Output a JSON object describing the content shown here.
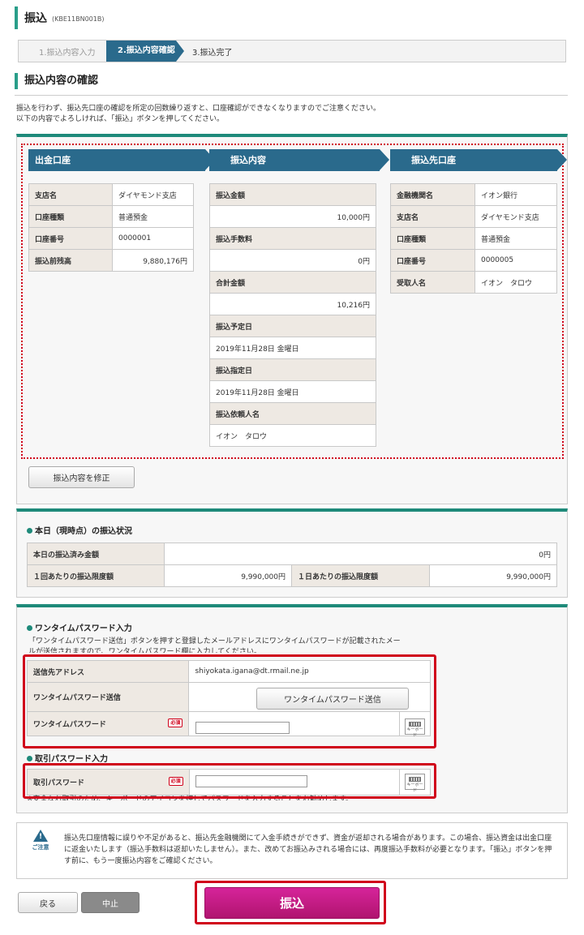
{
  "header": {
    "title": "振込",
    "code": "(KBE11BN001B)"
  },
  "steps": [
    "1.振込内容入力",
    "2.振込内容確認",
    "3.振込完了"
  ],
  "section_title": "振込内容の確認",
  "intro": [
    "振込を行わず、振込先口座の確認を所定の回数繰り返すと、口座確認ができなくなりますのでご注意ください。",
    "以下の内容でよろしければ、「振込」ボタンを押してください。"
  ],
  "from_account": {
    "heading": "出金口座",
    "rows": [
      {
        "label": "支店名",
        "value": "ダイヤモンド支店"
      },
      {
        "label": "口座種類",
        "value": "普通預金"
      },
      {
        "label": "口座番号",
        "value": "0000001"
      },
      {
        "label": "振込前残高",
        "value": "9,880,176円"
      }
    ]
  },
  "transfer": {
    "heading": "振込内容",
    "rows": [
      {
        "label": "振込金額",
        "value": "10,000円"
      },
      {
        "label": "振込手数料",
        "value": "0円"
      },
      {
        "label": "合計金額",
        "value": "10,216円"
      },
      {
        "label": "振込予定日",
        "value": "2019年11月28日 金曜日"
      },
      {
        "label": "振込指定日",
        "value": "2019年11月28日 金曜日"
      },
      {
        "label": "振込依頼人名",
        "value": "イオン　タロウ"
      }
    ]
  },
  "to_account": {
    "heading": "振込先口座",
    "rows": [
      {
        "label": "金融機関名",
        "value": "イオン銀行"
      },
      {
        "label": "支店名",
        "value": "ダイヤモンド支店"
      },
      {
        "label": "口座種類",
        "value": "普通預金"
      },
      {
        "label": "口座番号",
        "value": "0000005"
      },
      {
        "label": "受取人名",
        "value": "イオン　タロウ"
      }
    ]
  },
  "modify_button": "振込内容を修正",
  "status": {
    "title": "本日（現時点）の振込状況",
    "today_label": "本日の振込済み金額",
    "today_value": "0円",
    "per_label": "１回あたりの振込限度額",
    "per_value": "9,990,000円",
    "day_label": "１日あたりの振込限度額",
    "day_value": "9,990,000円"
  },
  "otp": {
    "title": "ワンタイムパスワード入力",
    "desc1": "「ワンタイムパスワード送信」ボタンを押すと登録したメールアドレスにワンタイムパスワードが記載されたメー",
    "desc2": "ルが送信されますので、ワンタイムパスワード欄に入力してください。",
    "email_label": "送信先アドレス",
    "email_value": "shiyokata.igana@dt.rmail.ne.jp",
    "send_label": "ワンタイムパスワード送信",
    "send_button": "ワンタイムパスワード送信",
    "pw_label": "ワンタイムパスワード",
    "required": "必須",
    "keyboard": "キーボード"
  },
  "txn": {
    "title": "取引パスワード入力",
    "pw_label": "取引パスワード",
    "required": "必須",
    "keyboard": "キーボード",
    "note": "※安全なお取引のため、キーボードのアイコンを押してパスワードを入力することをお勧めします。"
  },
  "notice": {
    "icon_label": "ご注意",
    "text": "振込先口座情報に誤りや不足があると、振込先金融機関にて入金手続きができず、資金が返却される場合があります。この場合、振込資金は出金口座に返金いたします（振込手数料は返却いたしません）。また、改めてお振込みされる場合には、再度振込手数料が必要となります。「振込」ボタンを押す前に、もう一度振込内容をご確認ください。"
  },
  "buttons": {
    "back": "戻る",
    "cancel": "中止",
    "submit": "振込"
  },
  "colors": {
    "accent": "#2a9e8a",
    "header_blue": "#2a6a8c",
    "submit": "#c2187f",
    "alert_red": "#d0021b"
  }
}
